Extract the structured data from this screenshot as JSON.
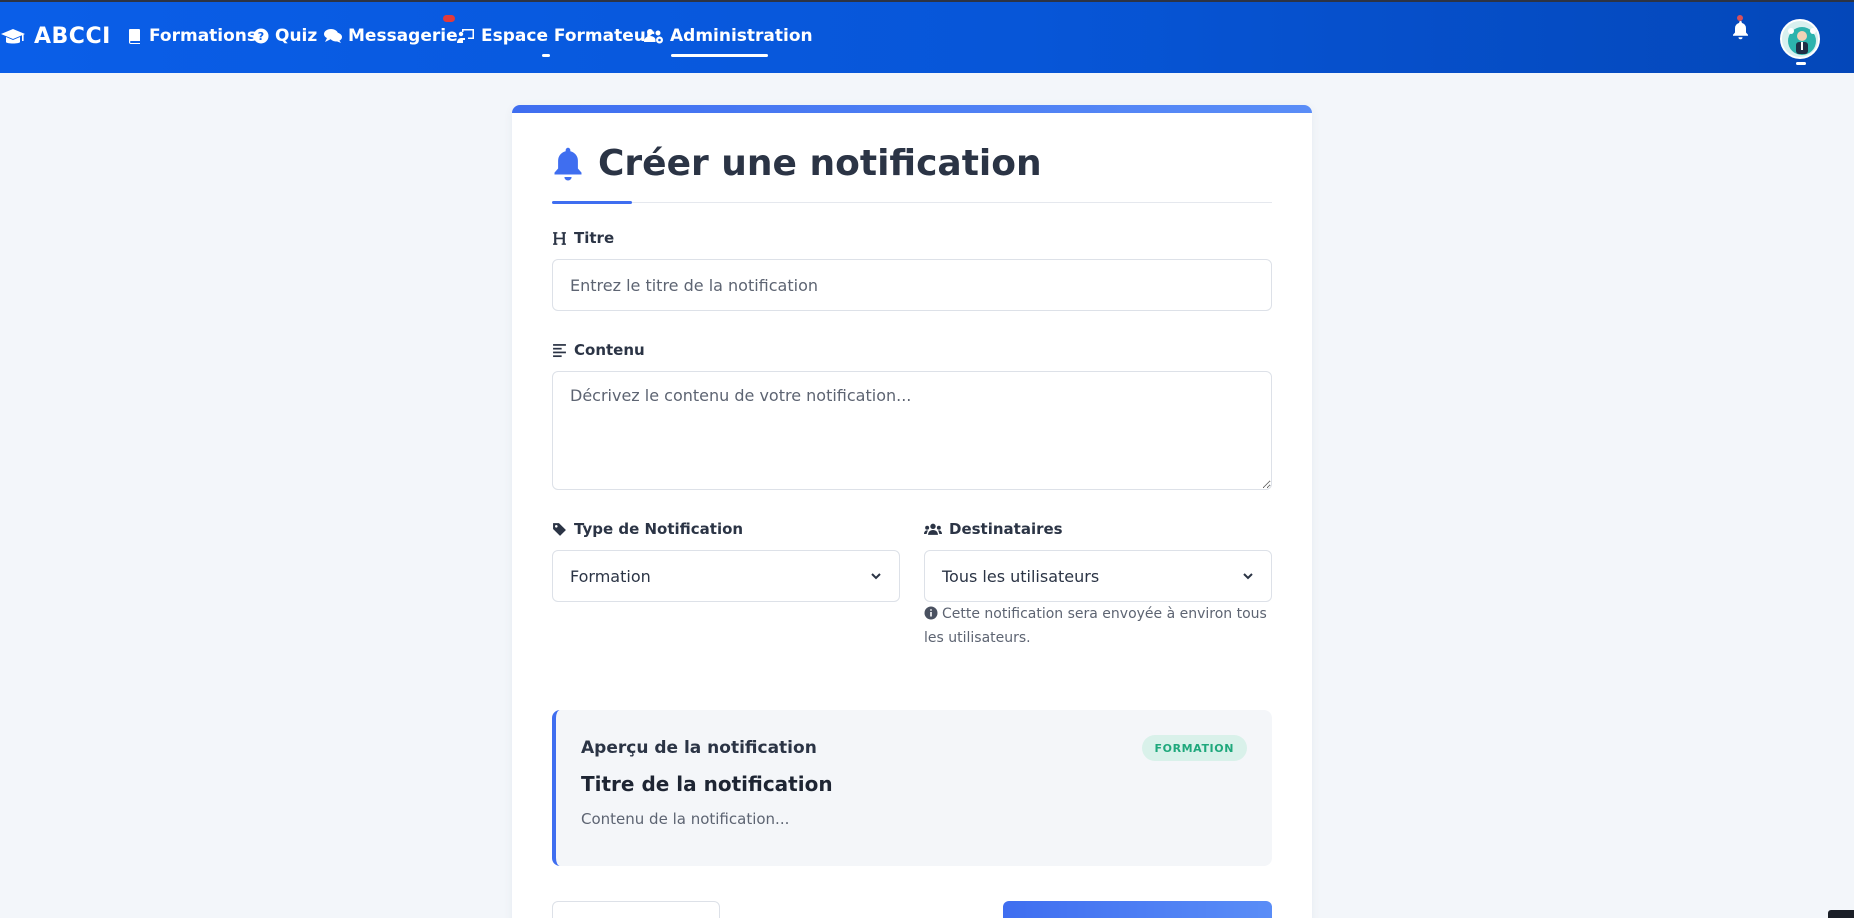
{
  "nav": {
    "brand": "ABCCI",
    "items": [
      {
        "label": "Formations",
        "icon": "book-icon"
      },
      {
        "label": "Quiz",
        "icon": "question-circle-icon"
      },
      {
        "label": "Messagerie",
        "icon": "comments-icon"
      },
      {
        "label": "Espace Formateur",
        "icon": "chalkboard-teacher-icon"
      },
      {
        "label": "Administration",
        "icon": "users-cog-icon",
        "active": true
      }
    ],
    "colors": {
      "bar_start": "#0a5ee8",
      "bar_end": "#0447b9",
      "badge": "#e23a3a"
    }
  },
  "form": {
    "title": "Créer une notification",
    "titre_label": "Titre",
    "titre_placeholder": "Entrez le titre de la notification",
    "titre_value": "",
    "contenu_label": "Contenu",
    "contenu_placeholder": "Décrivez le contenu de votre notification...",
    "contenu_value": "",
    "type_label": "Type de Notification",
    "type_value": "Formation",
    "dest_label": "Destinataires",
    "dest_value": "Tous les utilisateurs",
    "dest_help": "Cette notification sera envoyée à environ tous les utilisateurs."
  },
  "preview": {
    "heading": "Aperçu de la notification",
    "badge": "FORMATION",
    "title": "Titre de la notification",
    "content": "Contenu de la notification..."
  },
  "colors": {
    "accent": "#3f6ef0",
    "badge_bg": "#d9f1ea",
    "badge_text": "#1fa87c"
  }
}
